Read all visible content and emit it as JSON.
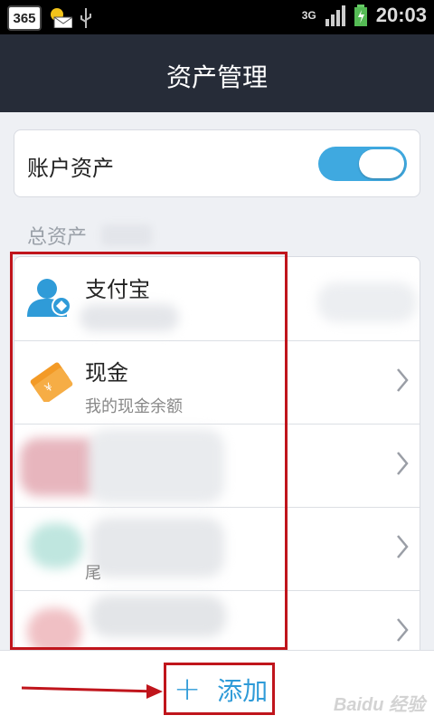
{
  "status_bar": {
    "app_badge": "365",
    "network": "3G",
    "clock": "20:03"
  },
  "header": {
    "title": "资产管理"
  },
  "account_assets": {
    "label": "账户资产",
    "enabled": true
  },
  "total_assets_label": "总资产",
  "assets": [
    {
      "name": "支付宝",
      "subtitle": "",
      "icon": "alipay-user-icon"
    },
    {
      "name": "现金",
      "subtitle": "我的现金余额",
      "icon": "cash-icon"
    },
    {
      "name": "",
      "subtitle": "",
      "icon": "blurred-icon"
    },
    {
      "name": "",
      "subtitle": "尾",
      "icon": "blurred-icon"
    },
    {
      "name": "",
      "subtitle": "",
      "icon": "blurred-icon"
    }
  ],
  "bottom": {
    "add_label": "添加",
    "add_icon": "plus-icon"
  },
  "watermark": "Baidu 经验",
  "colors": {
    "accent": "#2f9bd8",
    "toggle_on": "#3fa9e0",
    "header_bg": "#262c38",
    "annotation_red": "#c0151c"
  }
}
